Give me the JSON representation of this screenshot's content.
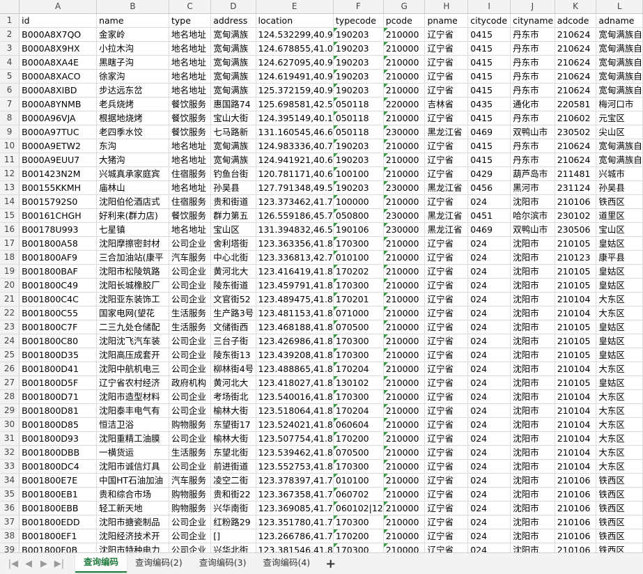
{
  "columns": [
    "A",
    "B",
    "C",
    "D",
    "E",
    "F",
    "G",
    "H",
    "I",
    "J",
    "K",
    "L"
  ],
  "header_row": [
    "id",
    "name",
    "type",
    "address",
    "location",
    "typecode",
    "pcode",
    "pname",
    "citycode",
    "cityname",
    "adcode",
    "adname"
  ],
  "rows": [
    [
      "B000A8X7QO",
      "金家岭",
      "地名地址",
      "宽甸满族",
      "124.532299,40.9",
      "190203",
      "210000",
      "辽宁省",
      "0415",
      "丹东市",
      "210624",
      "宽甸满族自"
    ],
    [
      "B000A8X9HX",
      "小拉木沟",
      "地名地址",
      "宽甸满族",
      "124.678855,41.0",
      "190203",
      "210000",
      "辽宁省",
      "0415",
      "丹东市",
      "210624",
      "宽甸满族自"
    ],
    [
      "B000A8XA4E",
      "黑瞎子沟",
      "地名地址",
      "宽甸满族",
      "124.627095,40.9",
      "190203",
      "210000",
      "辽宁省",
      "0415",
      "丹东市",
      "210624",
      "宽甸满族自"
    ],
    [
      "B000A8XACO",
      "徐家沟",
      "地名地址",
      "宽甸满族",
      "124.619491,40.9",
      "190203",
      "210000",
      "辽宁省",
      "0415",
      "丹东市",
      "210624",
      "宽甸满族自"
    ],
    [
      "B000A8XIBD",
      "步达远东岔",
      "地名地址",
      "宽甸满族",
      "125.372159,40.9",
      "190203",
      "210000",
      "辽宁省",
      "0415",
      "丹东市",
      "210624",
      "宽甸满族自"
    ],
    [
      "B000A8YNMB",
      "老兵烧烤",
      "餐饮服务",
      "惠国路74",
      "125.698581,42.5",
      "050118",
      "220000",
      "吉林省",
      "0435",
      "通化市",
      "220581",
      "梅河口市"
    ],
    [
      "B000A96VJA",
      "根据地烧烤",
      "餐饮服务",
      "宝山大街",
      "124.395149,40.1",
      "050118",
      "210000",
      "辽宁省",
      "0415",
      "丹东市",
      "210602",
      "元宝区"
    ],
    [
      "B000A97TUC",
      "老四季水饺",
      "餐饮服务",
      "七马路新",
      "131.160545,46.6",
      "050118",
      "230000",
      "黑龙江省",
      "0469",
      "双鸭山市",
      "230502",
      "尖山区"
    ],
    [
      "B000A9ETW2",
      "东沟",
      "地名地址",
      "宽甸满族",
      "124.983336,40.7",
      "190203",
      "210000",
      "辽宁省",
      "0415",
      "丹东市",
      "210624",
      "宽甸满族自"
    ],
    [
      "B000A9EUU7",
      "大猪沟",
      "地名地址",
      "宽甸满族",
      "124.941921,40.6",
      "190203",
      "210000",
      "辽宁省",
      "0415",
      "丹东市",
      "210624",
      "宽甸满族自"
    ],
    [
      "B001423N2M",
      "兴城真承家庭宾",
      "住宿服务",
      "钓鱼台街",
      "120.781171,40.6",
      "100100",
      "210000",
      "辽宁省",
      "0429",
      "葫芦岛市",
      "211481",
      "兴城市"
    ],
    [
      "B00155KKMH",
      "庙林山",
      "地名地址",
      "孙吴县",
      "127.791348,49.5",
      "190203",
      "230000",
      "黑龙江省",
      "0456",
      "黑河市",
      "231124",
      "孙吴县"
    ],
    [
      "B0015792S0",
      "沈阳伯伦酒店式",
      "住宿服务",
      "贵和街道",
      "123.373462,41.7",
      "100000",
      "210000",
      "辽宁省",
      "024",
      "沈阳市",
      "210106",
      "铁西区"
    ],
    [
      "B00161CHGH",
      "好利来(群力店)",
      "餐饮服务",
      "群力第五",
      "126.559186,45.7",
      "050800",
      "230000",
      "黑龙江省",
      "0451",
      "哈尔滨市",
      "230102",
      "道里区"
    ],
    [
      "B00178U993",
      "七星镇",
      "地名地址",
      "宝山区",
      "131.394832,46.5",
      "190106",
      "230000",
      "黑龙江省",
      "0469",
      "双鸭山市",
      "230506",
      "宝山区"
    ],
    [
      "B001800A58",
      "沈阳摩擦密封材",
      "公司企业",
      "舍利塔街",
      "123.363356,41.8",
      "170300",
      "210000",
      "辽宁省",
      "024",
      "沈阳市",
      "210105",
      "皇姑区"
    ],
    [
      "B001800AF9",
      "三合加油站(康平",
      "汽车服务",
      "中心北街",
      "123.336813,42.7",
      "010100",
      "210000",
      "辽宁省",
      "024",
      "沈阳市",
      "210123",
      "康平县"
    ],
    [
      "B001800BAF",
      "沈阳市松陵筑路",
      "公司企业",
      "黄河北大",
      "123.416419,41.8",
      "170202",
      "210000",
      "辽宁省",
      "024",
      "沈阳市",
      "210105",
      "皇姑区"
    ],
    [
      "B001800C49",
      "沈阳长城橡胶厂",
      "公司企业",
      "陵东街道",
      "123.459791,41.8",
      "170300",
      "210000",
      "辽宁省",
      "024",
      "沈阳市",
      "210105",
      "皇姑区"
    ],
    [
      "B001800C4C",
      "沈阳亚东装饰工",
      "公司企业",
      "文官街52",
      "123.489475,41.8",
      "170201",
      "210000",
      "辽宁省",
      "024",
      "沈阳市",
      "210104",
      "大东区"
    ],
    [
      "B001800C55",
      "国家电网(望花",
      "生活服务",
      "生产路3号",
      "123.481153,41.8",
      "071000",
      "210000",
      "辽宁省",
      "024",
      "沈阳市",
      "210104",
      "大东区"
    ],
    [
      "B001800C7F",
      "二三九处仓储配",
      "生活服务",
      "文储街西",
      "123.468188,41.8",
      "070500",
      "210000",
      "辽宁省",
      "024",
      "沈阳市",
      "210105",
      "皇姑区"
    ],
    [
      "B001800C80",
      "沈阳沈飞汽车装",
      "公司企业",
      "三台子街",
      "123.426986,41.8",
      "170300",
      "210000",
      "辽宁省",
      "024",
      "沈阳市",
      "210105",
      "皇姑区"
    ],
    [
      "B001800D35",
      "沈阳高压成套开",
      "公司企业",
      "陵东街13",
      "123.439208,41.8",
      "170300",
      "210000",
      "辽宁省",
      "024",
      "沈阳市",
      "210105",
      "皇姑区"
    ],
    [
      "B001800D41",
      "沈阳中航机电三",
      "公司企业",
      "柳林街4号",
      "123.488865,41.8",
      "170204",
      "210000",
      "辽宁省",
      "024",
      "沈阳市",
      "210104",
      "大东区"
    ],
    [
      "B001800D5F",
      "辽宁省农村经济",
      "政府机构",
      "黄河北大",
      "123.418027,41.8",
      "130102",
      "210000",
      "辽宁省",
      "024",
      "沈阳市",
      "210105",
      "皇姑区"
    ],
    [
      "B001800D71",
      "沈阳市造型材料",
      "公司企业",
      "考场街北",
      "123.540016,41.8",
      "170300",
      "210000",
      "辽宁省",
      "024",
      "沈阳市",
      "210104",
      "大东区"
    ],
    [
      "B001800D81",
      "沈阳泰丰电气有",
      "公司企业",
      "榆林大街",
      "123.518064,41.8",
      "170204",
      "210000",
      "辽宁省",
      "024",
      "沈阳市",
      "210104",
      "大东区"
    ],
    [
      "B001800D85",
      "恒洁卫浴",
      "购物服务",
      "东望街17",
      "123.524021,41.8",
      "060604",
      "210000",
      "辽宁省",
      "024",
      "沈阳市",
      "210104",
      "大东区"
    ],
    [
      "B001800D93",
      "沈阳重精工油膜",
      "公司企业",
      "榆林大街",
      "123.507754,41.8",
      "170200",
      "210000",
      "辽宁省",
      "024",
      "沈阳市",
      "210104",
      "大东区"
    ],
    [
      "B001800DBB",
      "一横货运",
      "生活服务",
      "东望北街",
      "123.539462,41.8",
      "070500",
      "210000",
      "辽宁省",
      "024",
      "沈阳市",
      "210104",
      "大东区"
    ],
    [
      "B001800DC4",
      "沈阳市诚信灯具",
      "公司企业",
      "前进街道",
      "123.552753,41.8",
      "170300",
      "210000",
      "辽宁省",
      "024",
      "沈阳市",
      "210104",
      "大东区"
    ],
    [
      "B001800E7E",
      "中国HT石油加油",
      "汽车服务",
      "凌空二街",
      "123.378397,41.7",
      "010100",
      "210000",
      "辽宁省",
      "024",
      "沈阳市",
      "210106",
      "铁西区"
    ],
    [
      "B001800EB1",
      "贵和综合市场",
      "购物服务",
      "贵和街22",
      "123.367358,41.7",
      "060702",
      "210000",
      "辽宁省",
      "024",
      "沈阳市",
      "210106",
      "铁西区"
    ],
    [
      "B001800EBB",
      "轻工新天地",
      "购物服务",
      "兴华南街",
      "123.369085,41.7",
      "060102|12",
      "210000",
      "辽宁省",
      "024",
      "沈阳市",
      "210106",
      "铁西区"
    ],
    [
      "B001800EDD",
      "沈阳市搪瓷制品",
      "公司企业",
      "红粉路29",
      "123.351780,41.7",
      "170300",
      "210000",
      "辽宁省",
      "024",
      "沈阳市",
      "210106",
      "铁西区"
    ],
    [
      "B001800EF1",
      "沈阳经济技术开",
      "公司企业",
      "[]",
      "123.266786,41.7",
      "170200",
      "210000",
      "辽宁省",
      "024",
      "沈阳市",
      "210106",
      "铁西区"
    ],
    [
      "B001800F0B",
      "沈阳市特种电力",
      "公司企业",
      "兴华北街",
      "123.381546,41.8",
      "170300",
      "210000",
      "辽宁省",
      "024",
      "沈阳市",
      "210106",
      "铁西区"
    ]
  ],
  "sheet_tabs": [
    "查询编码",
    "查询编码(2)",
    "查询编码(3)",
    "查询编码(4)"
  ],
  "add_tab_label": "+",
  "nav_icons": [
    "first-sheet-icon",
    "prev-sheet-icon",
    "next-sheet-icon",
    "last-sheet-icon"
  ],
  "nav_glyphs": [
    "|◀",
    "◀",
    "▶",
    "▶|"
  ],
  "colors": {
    "active_tab": "#1f7a3c",
    "error_indicator": "#3a9a46",
    "grid": "#dcdcdc",
    "header_bg": "#f3f3f3"
  }
}
